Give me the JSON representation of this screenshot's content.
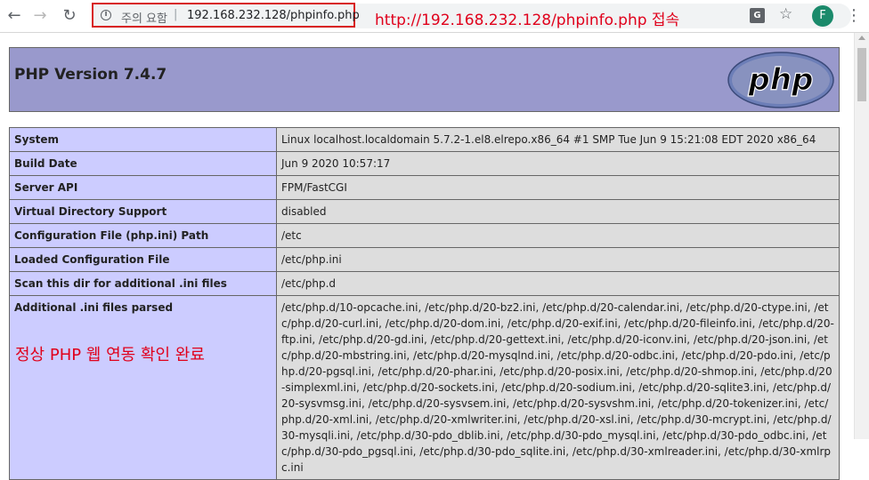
{
  "browser": {
    "security_label": "주의 요함",
    "separator": "|",
    "url": "192.168.232.128/phpinfo.php",
    "annotation_url": "http://192.168.232.128/phpinfo.php 접속",
    "avatar_letter": "F",
    "back_icon": "arrow-left",
    "forward_icon": "arrow-right",
    "reload_icon": "reload",
    "accent_annotation_color": "#e0001b"
  },
  "php": {
    "title": "PHP Version 7.4.7",
    "logo_text": "php",
    "header_color": "#9999cc"
  },
  "table": {
    "rows": [
      {
        "key": "System",
        "value": "Linux localhost.localdomain 5.7.2-1.el8.elrepo.x86_64 #1 SMP Tue Jun 9 15:21:08 EDT 2020 x86_64"
      },
      {
        "key": "Build Date",
        "value": "Jun 9 2020 10:57:17"
      },
      {
        "key": "Server API",
        "value": "FPM/FastCGI"
      },
      {
        "key": "Virtual Directory Support",
        "value": "disabled"
      },
      {
        "key": "Configuration File (php.ini) Path",
        "value": "/etc"
      },
      {
        "key": "Loaded Configuration File",
        "value": "/etc/php.ini"
      },
      {
        "key": "Scan this dir for additional .ini files",
        "value": "/etc/php.d"
      },
      {
        "key": "Additional .ini files parsed",
        "value": "/etc/php.d/10-opcache.ini, /etc/php.d/20-bz2.ini, /etc/php.d/20-calendar.ini, /etc/php.d/20-ctype.ini, /etc/php.d/20-curl.ini, /etc/php.d/20-dom.ini, /etc/php.d/20-exif.ini, /etc/php.d/20-fileinfo.ini, /etc/php.d/20-ftp.ini, /etc/php.d/20-gd.ini, /etc/php.d/20-gettext.ini, /etc/php.d/20-iconv.ini, /etc/php.d/20-json.ini, /etc/php.d/20-mbstring.ini, /etc/php.d/20-mysqlnd.ini, /etc/php.d/20-odbc.ini, /etc/php.d/20-pdo.ini, /etc/php.d/20-pgsql.ini, /etc/php.d/20-phar.ini, /etc/php.d/20-posix.ini, /etc/php.d/20-shmop.ini, /etc/php.d/20-simplexml.ini, /etc/php.d/20-sockets.ini, /etc/php.d/20-sodium.ini, /etc/php.d/20-sqlite3.ini, /etc/php.d/20-sysvmsg.ini, /etc/php.d/20-sysvsem.ini, /etc/php.d/20-sysvshm.ini, /etc/php.d/20-tokenizer.ini, /etc/php.d/20-xml.ini, /etc/php.d/20-xmlwriter.ini, /etc/php.d/20-xsl.ini, /etc/php.d/30-mcrypt.ini, /etc/php.d/30-mysqli.ini, /etc/php.d/30-pdo_dblib.ini, /etc/php.d/30-pdo_mysql.ini, /etc/php.d/30-pdo_odbc.ini, /etc/php.d/30-pdo_pgsql.ini, /etc/php.d/30-pdo_sqlite.ini, /etc/php.d/30-xmlreader.ini, /etc/php.d/30-xmlrpc.ini"
      }
    ]
  },
  "annotation_ok": "정상 PHP 웹 연동 확인 완료"
}
